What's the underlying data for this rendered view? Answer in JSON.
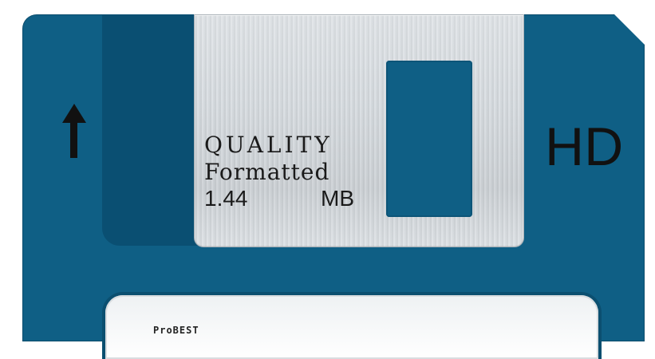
{
  "disk": {
    "capacity_label": "HD",
    "shutter": {
      "line1": "QUALITY",
      "line2": "Formatted",
      "capacity_value": "1.44",
      "capacity_unit": "MB"
    },
    "label_brand": "ProBEST"
  },
  "colors": {
    "disk_blue": "#0f5f85",
    "shutter_silver": "#d8dde1",
    "text_black": "#111111"
  },
  "icons": {
    "write_protect_arrow": "up-arrow-icon"
  }
}
